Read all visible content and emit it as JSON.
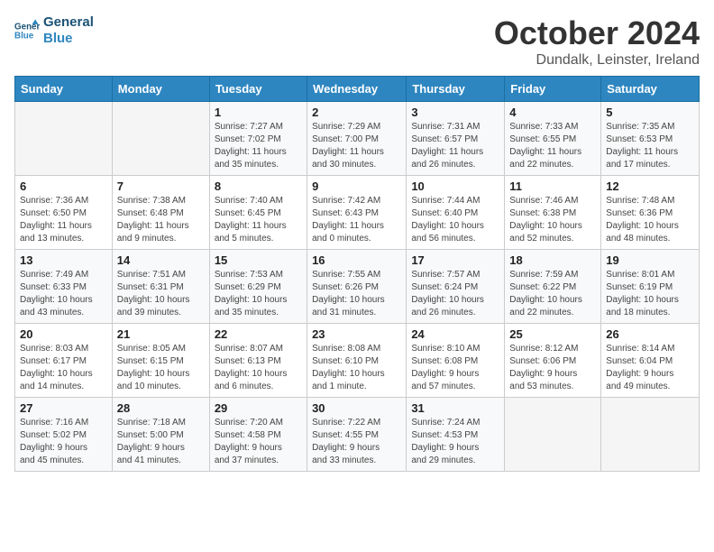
{
  "header": {
    "logo_line1": "General",
    "logo_line2": "Blue",
    "month": "October 2024",
    "location": "Dundalk, Leinster, Ireland"
  },
  "weekdays": [
    "Sunday",
    "Monday",
    "Tuesday",
    "Wednesday",
    "Thursday",
    "Friday",
    "Saturday"
  ],
  "weeks": [
    [
      {
        "day": "",
        "info": ""
      },
      {
        "day": "",
        "info": ""
      },
      {
        "day": "1",
        "info": "Sunrise: 7:27 AM\nSunset: 7:02 PM\nDaylight: 11 hours\nand 35 minutes."
      },
      {
        "day": "2",
        "info": "Sunrise: 7:29 AM\nSunset: 7:00 PM\nDaylight: 11 hours\nand 30 minutes."
      },
      {
        "day": "3",
        "info": "Sunrise: 7:31 AM\nSunset: 6:57 PM\nDaylight: 11 hours\nand 26 minutes."
      },
      {
        "day": "4",
        "info": "Sunrise: 7:33 AM\nSunset: 6:55 PM\nDaylight: 11 hours\nand 22 minutes."
      },
      {
        "day": "5",
        "info": "Sunrise: 7:35 AM\nSunset: 6:53 PM\nDaylight: 11 hours\nand 17 minutes."
      }
    ],
    [
      {
        "day": "6",
        "info": "Sunrise: 7:36 AM\nSunset: 6:50 PM\nDaylight: 11 hours\nand 13 minutes."
      },
      {
        "day": "7",
        "info": "Sunrise: 7:38 AM\nSunset: 6:48 PM\nDaylight: 11 hours\nand 9 minutes."
      },
      {
        "day": "8",
        "info": "Sunrise: 7:40 AM\nSunset: 6:45 PM\nDaylight: 11 hours\nand 5 minutes."
      },
      {
        "day": "9",
        "info": "Sunrise: 7:42 AM\nSunset: 6:43 PM\nDaylight: 11 hours\nand 0 minutes."
      },
      {
        "day": "10",
        "info": "Sunrise: 7:44 AM\nSunset: 6:40 PM\nDaylight: 10 hours\nand 56 minutes."
      },
      {
        "day": "11",
        "info": "Sunrise: 7:46 AM\nSunset: 6:38 PM\nDaylight: 10 hours\nand 52 minutes."
      },
      {
        "day": "12",
        "info": "Sunrise: 7:48 AM\nSunset: 6:36 PM\nDaylight: 10 hours\nand 48 minutes."
      }
    ],
    [
      {
        "day": "13",
        "info": "Sunrise: 7:49 AM\nSunset: 6:33 PM\nDaylight: 10 hours\nand 43 minutes."
      },
      {
        "day": "14",
        "info": "Sunrise: 7:51 AM\nSunset: 6:31 PM\nDaylight: 10 hours\nand 39 minutes."
      },
      {
        "day": "15",
        "info": "Sunrise: 7:53 AM\nSunset: 6:29 PM\nDaylight: 10 hours\nand 35 minutes."
      },
      {
        "day": "16",
        "info": "Sunrise: 7:55 AM\nSunset: 6:26 PM\nDaylight: 10 hours\nand 31 minutes."
      },
      {
        "day": "17",
        "info": "Sunrise: 7:57 AM\nSunset: 6:24 PM\nDaylight: 10 hours\nand 26 minutes."
      },
      {
        "day": "18",
        "info": "Sunrise: 7:59 AM\nSunset: 6:22 PM\nDaylight: 10 hours\nand 22 minutes."
      },
      {
        "day": "19",
        "info": "Sunrise: 8:01 AM\nSunset: 6:19 PM\nDaylight: 10 hours\nand 18 minutes."
      }
    ],
    [
      {
        "day": "20",
        "info": "Sunrise: 8:03 AM\nSunset: 6:17 PM\nDaylight: 10 hours\nand 14 minutes."
      },
      {
        "day": "21",
        "info": "Sunrise: 8:05 AM\nSunset: 6:15 PM\nDaylight: 10 hours\nand 10 minutes."
      },
      {
        "day": "22",
        "info": "Sunrise: 8:07 AM\nSunset: 6:13 PM\nDaylight: 10 hours\nand 6 minutes."
      },
      {
        "day": "23",
        "info": "Sunrise: 8:08 AM\nSunset: 6:10 PM\nDaylight: 10 hours\nand 1 minute."
      },
      {
        "day": "24",
        "info": "Sunrise: 8:10 AM\nSunset: 6:08 PM\nDaylight: 9 hours\nand 57 minutes."
      },
      {
        "day": "25",
        "info": "Sunrise: 8:12 AM\nSunset: 6:06 PM\nDaylight: 9 hours\nand 53 minutes."
      },
      {
        "day": "26",
        "info": "Sunrise: 8:14 AM\nSunset: 6:04 PM\nDaylight: 9 hours\nand 49 minutes."
      }
    ],
    [
      {
        "day": "27",
        "info": "Sunrise: 7:16 AM\nSunset: 5:02 PM\nDaylight: 9 hours\nand 45 minutes."
      },
      {
        "day": "28",
        "info": "Sunrise: 7:18 AM\nSunset: 5:00 PM\nDaylight: 9 hours\nand 41 minutes."
      },
      {
        "day": "29",
        "info": "Sunrise: 7:20 AM\nSunset: 4:58 PM\nDaylight: 9 hours\nand 37 minutes."
      },
      {
        "day": "30",
        "info": "Sunrise: 7:22 AM\nSunset: 4:55 PM\nDaylight: 9 hours\nand 33 minutes."
      },
      {
        "day": "31",
        "info": "Sunrise: 7:24 AM\nSunset: 4:53 PM\nDaylight: 9 hours\nand 29 minutes."
      },
      {
        "day": "",
        "info": ""
      },
      {
        "day": "",
        "info": ""
      }
    ]
  ]
}
